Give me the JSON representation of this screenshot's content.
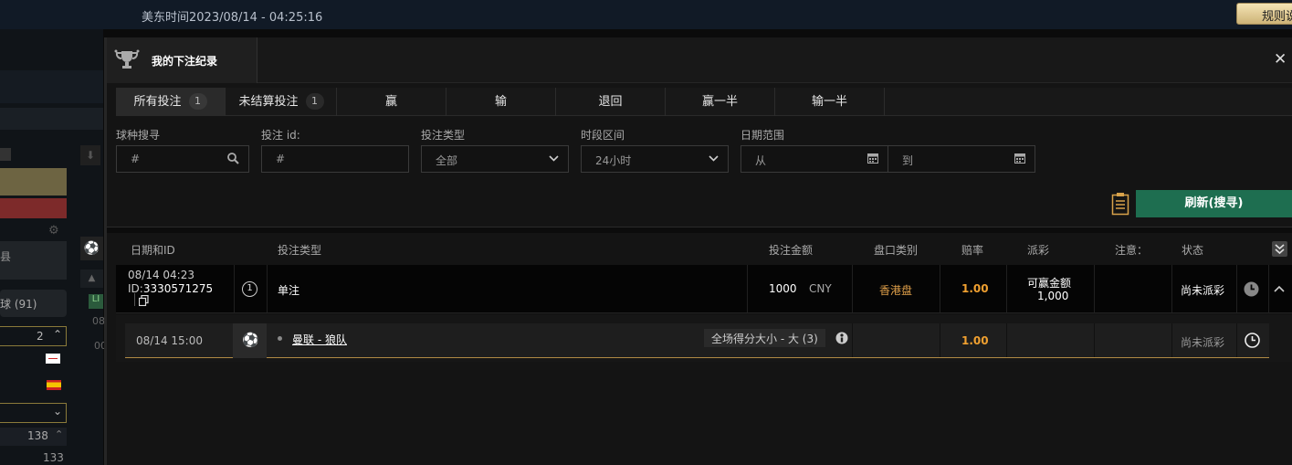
{
  "topbar": {
    "time": "美东时间2023/08/14 - 04:25:16",
    "rules_button": "规则说"
  },
  "background_left": {
    "soccer_count": "球 (91)",
    "count_2": "2",
    "count_138": "138",
    "count_133": "133",
    "misc_00": "00",
    "misc_08": "08",
    "misc_ll": "LI",
    "label_e": "县"
  },
  "modal": {
    "title": "我的下注纪录",
    "close": "✕",
    "tabs": [
      {
        "label": "所有投注",
        "count": "1"
      },
      {
        "label": "未结算投注",
        "count": "1"
      },
      {
        "label": "赢"
      },
      {
        "label": "输"
      },
      {
        "label": "退回"
      },
      {
        "label": "赢一半"
      },
      {
        "label": "输一半"
      }
    ],
    "filters": {
      "sport_label": "球种搜寻",
      "sport_placeholder": "#",
      "betid_label": "投注 id:",
      "betid_placeholder": "#",
      "bettype_label": "投注类型",
      "bettype_value": "全部",
      "period_label": "时段区间",
      "period_value": "24小时",
      "date_label": "日期范围",
      "date_from": "从",
      "date_to": "到"
    },
    "refresh_button": "刷新(搜寻)",
    "table": {
      "headers": {
        "date_id": "日期和ID",
        "bet_type": "投注类型",
        "amount": "投注金额",
        "market": "盘口类别",
        "odds": "赔率",
        "payout": "派彩",
        "note": "注意：",
        "status": "状态"
      },
      "bet": {
        "date": "08/14 04:23",
        "id_prefix": "ID:",
        "id": "3330571275",
        "num": "1",
        "type": "单注",
        "amount": "1000",
        "currency": "CNY",
        "market": "香港盘",
        "odds": "1.00",
        "payout_label": "可赢金额",
        "payout_value": "1,000",
        "status": "尚未派彩"
      },
      "detail": {
        "date": "08/14 15:00",
        "match": "曼联 - 狼队",
        "selection": "全场得分大小 - 大 (3)",
        "odds": "1.00",
        "status": "尚未派彩"
      }
    }
  }
}
